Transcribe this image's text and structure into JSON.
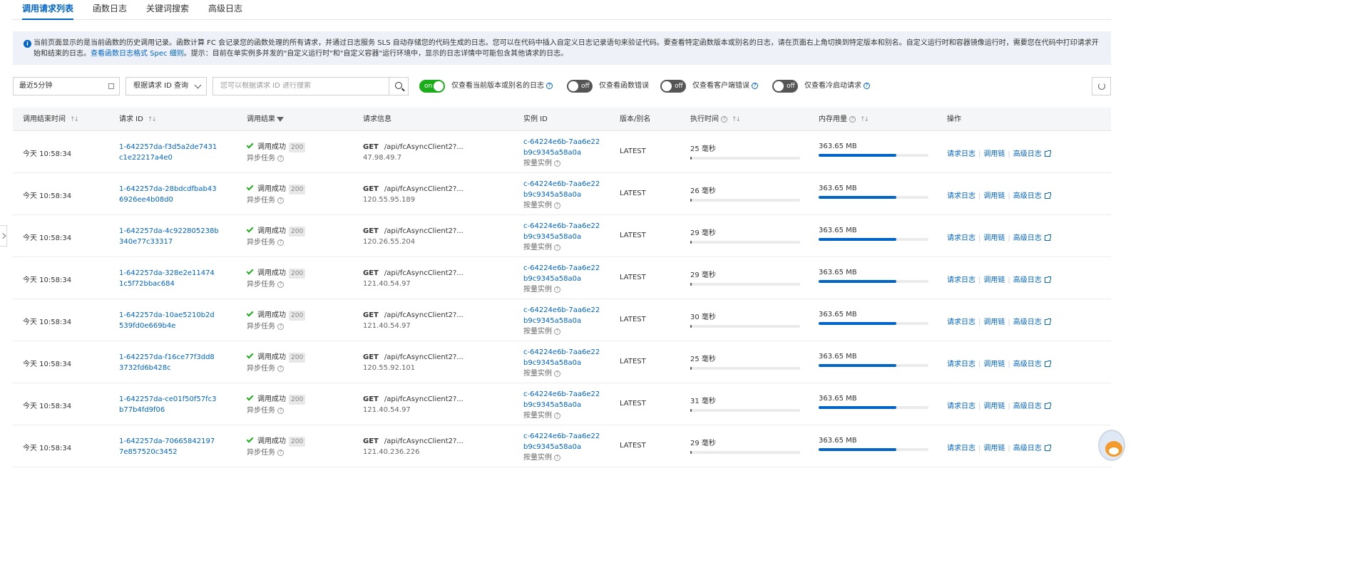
{
  "tabs": [
    {
      "label": "调用请求列表",
      "active": true
    },
    {
      "label": "函数日志",
      "active": false
    },
    {
      "label": "关键词搜索",
      "active": false
    },
    {
      "label": "高级日志",
      "active": false
    }
  ],
  "notice": {
    "text": "当前页面显示的是当前函数的历史调用记录。函数计算 FC 会记录您的函数处理的所有请求，并通过日志服务 SLS 自动存储您的代码生成的日志。您可以在代码中插入自定义日志记录语句来验证代码。要查看特定函数版本或别名的日志，请在页面右上角切换到特定版本和别名。自定义运行时和容器镜像运行时，需要您在代码中打印请求开始和结束的日志。",
    "link": "查看函数日志格式 Spec 细则",
    "tip": "。提示：目前在单实例多并发的\"自定义运行时\"和\"自定义容器\"运行环境中，显示的日志详情中可能包含其他请求的日志。"
  },
  "toolbar": {
    "date_range": "最近5分钟",
    "query_type": "根据请求 ID 查询",
    "search_placeholder": "您可以根据请求 ID 进行搜索",
    "toggles": [
      {
        "state": "on",
        "label": "仅查看当前版本或别名的日志"
      },
      {
        "state": "off",
        "label": "仅查看函数错误"
      },
      {
        "state": "off",
        "label": "仅查看客户端错误"
      },
      {
        "state": "off",
        "label": "仅查看冷启动请求"
      }
    ]
  },
  "table": {
    "headers": {
      "end_time": "调用结束时间",
      "request_id": "请求 ID",
      "result": "调用结果",
      "request_info": "请求信息",
      "instance_id": "实例 ID",
      "version": "版本/别名",
      "exec_time": "执行时间",
      "memory": "内存用量",
      "ops": "操作"
    },
    "rows": [
      {
        "time": "今天 10:58:34",
        "request_id": "1-642257da-f3d5a2de7431c1e22217a4e0",
        "result": "调用成功",
        "code": "200",
        "task": "异步任务",
        "method": "GET",
        "path": "/api/fcAsyncClient2?...",
        "ip": "47.98.49.7",
        "instance": "c-64224e6b-7aa6e22b9c9345a58a0a",
        "instance_type": "按量实例",
        "version": "LATEST",
        "exec": "25 毫秒",
        "exec_pct": 1,
        "mem": "363.65 MB",
        "mem_pct": 71
      },
      {
        "time": "今天 10:58:34",
        "request_id": "1-642257da-28bdcdfbab436926ee4b08d0",
        "result": "调用成功",
        "code": "200",
        "task": "异步任务",
        "method": "GET",
        "path": "/api/fcAsyncClient2?...",
        "ip": "120.55.95.189",
        "instance": "c-64224e6b-7aa6e22b9c9345a58a0a",
        "instance_type": "按量实例",
        "version": "LATEST",
        "exec": "26 毫秒",
        "exec_pct": 1,
        "mem": "363.65 MB",
        "mem_pct": 71
      },
      {
        "time": "今天 10:58:34",
        "request_id": "1-642257da-4c922805238b340e77c33317",
        "result": "调用成功",
        "code": "200",
        "task": "异步任务",
        "method": "GET",
        "path": "/api/fcAsyncClient2?...",
        "ip": "120.26.55.204",
        "instance": "c-64224e6b-7aa6e22b9c9345a58a0a",
        "instance_type": "按量实例",
        "version": "LATEST",
        "exec": "29 毫秒",
        "exec_pct": 1,
        "mem": "363.65 MB",
        "mem_pct": 71
      },
      {
        "time": "今天 10:58:34",
        "request_id": "1-642257da-328e2e114741c5f72bbac684",
        "result": "调用成功",
        "code": "200",
        "task": "异步任务",
        "method": "GET",
        "path": "/api/fcAsyncClient2?...",
        "ip": "121.40.54.97",
        "instance": "c-64224e6b-7aa6e22b9c9345a58a0a",
        "instance_type": "按量实例",
        "version": "LATEST",
        "exec": "29 毫秒",
        "exec_pct": 1,
        "mem": "363.65 MB",
        "mem_pct": 71
      },
      {
        "time": "今天 10:58:34",
        "request_id": "1-642257da-10ae5210b2d539fd0e669b4e",
        "result": "调用成功",
        "code": "200",
        "task": "异步任务",
        "method": "GET",
        "path": "/api/fcAsyncClient2?...",
        "ip": "121.40.54.97",
        "instance": "c-64224e6b-7aa6e22b9c9345a58a0a",
        "instance_type": "按量实例",
        "version": "LATEST",
        "exec": "30 毫秒",
        "exec_pct": 1,
        "mem": "363.65 MB",
        "mem_pct": 71
      },
      {
        "time": "今天 10:58:34",
        "request_id": "1-642257da-f16ce77f3dd83732fd6b428c",
        "result": "调用成功",
        "code": "200",
        "task": "异步任务",
        "method": "GET",
        "path": "/api/fcAsyncClient2?...",
        "ip": "120.55.92.101",
        "instance": "c-64224e6b-7aa6e22b9c9345a58a0a",
        "instance_type": "按量实例",
        "version": "LATEST",
        "exec": "25 毫秒",
        "exec_pct": 1,
        "mem": "363.65 MB",
        "mem_pct": 71
      },
      {
        "time": "今天 10:58:34",
        "request_id": "1-642257da-ce01f50f57fc3b77b4fd9f06",
        "result": "调用成功",
        "code": "200",
        "task": "异步任务",
        "method": "GET",
        "path": "/api/fcAsyncClient2?...",
        "ip": "121.40.54.97",
        "instance": "c-64224e6b-7aa6e22b9c9345a58a0a",
        "instance_type": "按量实例",
        "version": "LATEST",
        "exec": "31 毫秒",
        "exec_pct": 1,
        "mem": "363.65 MB",
        "mem_pct": 71
      },
      {
        "time": "今天 10:58:34",
        "request_id": "1-642257da-706658421977e857520c3452",
        "result": "调用成功",
        "code": "200",
        "task": "异步任务",
        "method": "GET",
        "path": "/api/fcAsyncClient2?...",
        "ip": "121.40.236.226",
        "instance": "c-64224e6b-7aa6e22b9c9345a58a0a",
        "instance_type": "按量实例",
        "version": "LATEST",
        "exec": "29 毫秒",
        "exec_pct": 1,
        "mem": "363.65 MB",
        "mem_pct": 71
      }
    ],
    "ops": {
      "request_log": "请求日志",
      "trace": "调用链",
      "advanced_log": "高级日志"
    }
  },
  "colors": {
    "accent": "#0064c8",
    "success": "#1aad19"
  }
}
